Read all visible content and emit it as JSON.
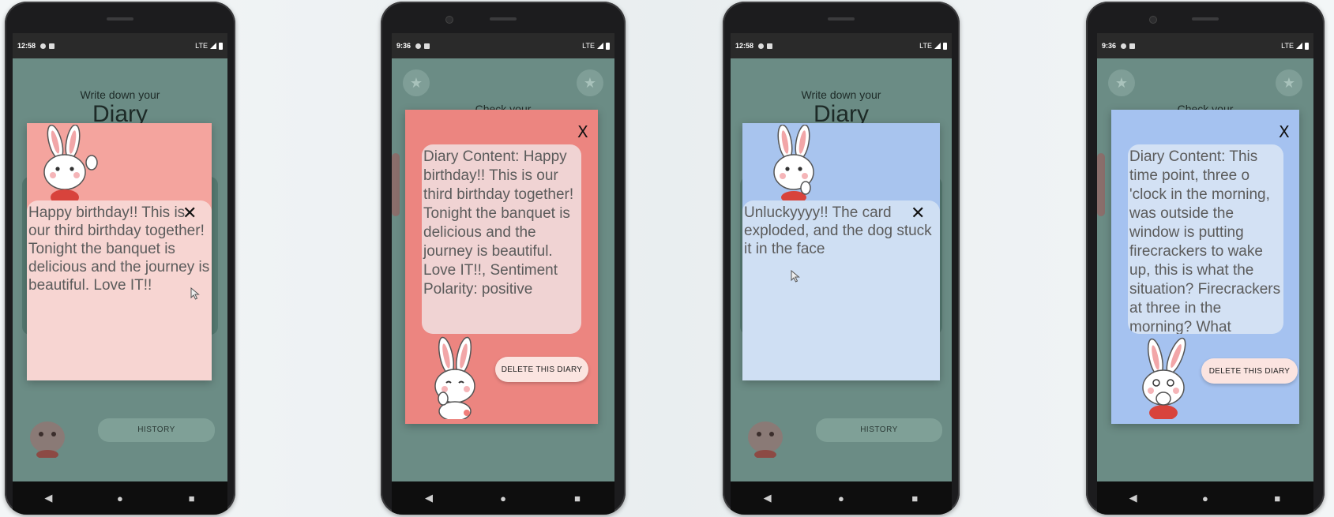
{
  "phones": [
    {
      "time": "12:58",
      "network": "LTE",
      "background": {
        "subtitle": "Write down your",
        "title": "Diary",
        "history_button": "HISTORY"
      },
      "dialog": {
        "close_label": "✕",
        "text": "Happy birthday!! This is our third birthday together! Tonight the banquet is delicious and the journey is beautiful. Love IT!!",
        "color": "#f4a49e",
        "panel_color": "#f7d5d2"
      }
    },
    {
      "time": "9:36",
      "network": "LTE",
      "background": {
        "partial_title": "Check your"
      },
      "dialog": {
        "close_label": "X",
        "text": "Diary Content: Happy birthday!! This is our third birthday together!\nTonight the banquet is delicious and the journey is beautiful. Love IT!!, Sentiment Polarity: positive",
        "delete_button": "DELETE THIS DIARY",
        "color": "#ec8580",
        "panel_color": "#f0d3d3"
      }
    },
    {
      "time": "12:58",
      "network": "LTE",
      "background": {
        "subtitle": "Write down your",
        "title": "Diary",
        "history_button": "HISTORY"
      },
      "dialog": {
        "close_label": "✕",
        "text": "Unluckyyyy!! The card exploded, and the dog stuck it in the face",
        "color": "#a8c4ee",
        "panel_color": "#cfdff3"
      }
    },
    {
      "time": "9:36",
      "network": "LTE",
      "background": {
        "partial_title": "Check your"
      },
      "dialog": {
        "close_label": "X",
        "text": "Diary Content: This time point, three o 'clock in the morning, was outside the window is putting firecrackers to wake up, this is what the situation? Firecrackers at three in the morning? What",
        "delete_button": "DELETE THIS DIARY",
        "color": "#a5c2f0",
        "panel_color": "#d3e1f4"
      }
    }
  ],
  "nav": {
    "back": "◀",
    "home": "●",
    "recents": "■"
  }
}
